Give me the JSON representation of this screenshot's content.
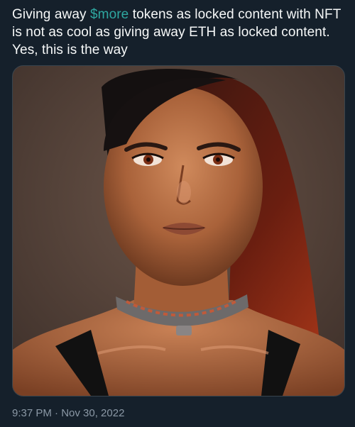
{
  "tweet": {
    "text_before": "Giving away ",
    "cashtag": "$more",
    "text_after": " tokens as locked content with NFT is not as cool as giving away ETH as locked content. Yes, this is the way",
    "timestamp": "9:37 PM · Nov 30, 2022",
    "link_color": "#2ea7a0"
  },
  "media": {
    "type": "photo",
    "subject": "portrait"
  },
  "theme": {
    "background": "#15202b",
    "text": "#f7f9f9",
    "secondary_text": "#8b98a5",
    "border": "#38444d"
  }
}
